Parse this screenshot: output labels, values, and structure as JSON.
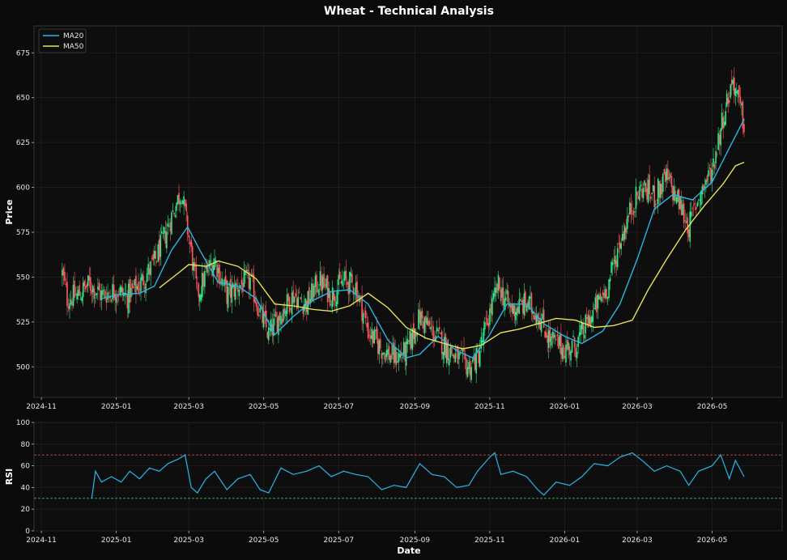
{
  "chart_data": [
    {
      "type": "candlestick",
      "title": "Wheat - Technical Analysis",
      "ylabel": "Price",
      "xlabel": "",
      "ylim": [
        483,
        690
      ],
      "xlim": [
        "2024-10-26",
        "2026-06-27"
      ],
      "yticks": [
        500,
        525,
        550,
        575,
        600,
        625,
        650,
        675
      ],
      "xticks": [
        "2024-11",
        "2025-01",
        "2025-03",
        "2025-05",
        "2025-07",
        "2025-09",
        "2025-11",
        "2026-01",
        "2026-03",
        "2026-05"
      ],
      "grid": true,
      "legend_position": "top-left",
      "up_color": "#2ee88a",
      "down_color": "#ff5a5f",
      "close_anchors": [
        [
          "2024-11-18",
          552
        ],
        [
          "2024-11-22",
          538
        ],
        [
          "2024-12-01",
          540
        ],
        [
          "2024-12-10",
          546
        ],
        [
          "2024-12-20",
          540
        ],
        [
          "2025-01-01",
          543
        ],
        [
          "2025-01-10",
          539
        ],
        [
          "2025-01-20",
          546
        ],
        [
          "2025-02-01",
          558
        ],
        [
          "2025-02-10",
          574
        ],
        [
          "2025-02-18",
          590
        ],
        [
          "2025-02-23",
          598
        ],
        [
          "2025-03-02",
          568
        ],
        [
          "2025-03-08",
          540
        ],
        [
          "2025-03-15",
          552
        ],
        [
          "2025-03-22",
          560
        ],
        [
          "2025-04-01",
          540
        ],
        [
          "2025-04-10",
          545
        ],
        [
          "2025-04-20",
          548
        ],
        [
          "2025-04-28",
          530
        ],
        [
          "2025-05-05",
          518
        ],
        [
          "2025-05-15",
          530
        ],
        [
          "2025-05-25",
          540
        ],
        [
          "2025-06-05",
          535
        ],
        [
          "2025-06-15",
          548
        ],
        [
          "2025-06-25",
          540
        ],
        [
          "2025-07-05",
          548
        ],
        [
          "2025-07-15",
          545
        ],
        [
          "2025-07-25",
          520
        ],
        [
          "2025-08-05",
          510
        ],
        [
          "2025-08-15",
          505
        ],
        [
          "2025-08-25",
          508
        ],
        [
          "2025-09-05",
          528
        ],
        [
          "2025-09-15",
          520
        ],
        [
          "2025-09-25",
          512
        ],
        [
          "2025-10-05",
          505
        ],
        [
          "2025-10-15",
          500
        ],
        [
          "2025-10-22",
          505
        ],
        [
          "2025-11-01",
          530
        ],
        [
          "2025-11-08",
          545
        ],
        [
          "2025-11-18",
          532
        ],
        [
          "2025-12-01",
          535
        ],
        [
          "2025-12-10",
          530
        ],
        [
          "2025-12-20",
          515
        ],
        [
          "2026-01-01",
          510
        ],
        [
          "2026-01-10",
          512
        ],
        [
          "2026-01-20",
          525
        ],
        [
          "2026-01-28",
          535
        ],
        [
          "2026-02-05",
          545
        ],
        [
          "2026-02-15",
          570
        ],
        [
          "2026-02-25",
          590
        ],
        [
          "2026-03-05",
          600
        ],
        [
          "2026-03-15",
          595
        ],
        [
          "2026-03-25",
          605
        ],
        [
          "2026-04-05",
          590
        ],
        [
          "2026-04-12",
          578
        ],
        [
          "2026-04-20",
          595
        ],
        [
          "2026-05-01",
          610
        ],
        [
          "2026-05-10",
          640
        ],
        [
          "2026-05-18",
          660
        ],
        [
          "2026-05-27",
          635
        ]
      ],
      "series": [
        {
          "name": "MA20",
          "color": "#29b6e8",
          "points": [
            [
              "2024-12-20",
              538
            ],
            [
              "2025-01-01",
              540
            ],
            [
              "2025-01-20",
              541
            ],
            [
              "2025-02-01",
              545
            ],
            [
              "2025-02-15",
              565
            ],
            [
              "2025-02-28",
              578
            ],
            [
              "2025-03-10",
              565
            ],
            [
              "2025-03-25",
              547
            ],
            [
              "2025-04-10",
              545
            ],
            [
              "2025-04-25",
              538
            ],
            [
              "2025-05-10",
              518
            ],
            [
              "2025-05-25",
              528
            ],
            [
              "2025-06-10",
              537
            ],
            [
              "2025-06-25",
              542
            ],
            [
              "2025-07-10",
              543
            ],
            [
              "2025-07-25",
              535
            ],
            [
              "2025-08-10",
              515
            ],
            [
              "2025-08-25",
              505
            ],
            [
              "2025-09-05",
              507
            ],
            [
              "2025-09-20",
              517
            ],
            [
              "2025-10-05",
              509
            ],
            [
              "2025-10-18",
              505
            ],
            [
              "2025-11-01",
              518
            ],
            [
              "2025-11-15",
              535
            ],
            [
              "2025-12-01",
              535
            ],
            [
              "2025-12-15",
              524
            ],
            [
              "2026-01-01",
              517
            ],
            [
              "2026-01-15",
              513
            ],
            [
              "2026-02-01",
              520
            ],
            [
              "2026-02-15",
              535
            ],
            [
              "2026-03-01",
              560
            ],
            [
              "2026-03-15",
              588
            ],
            [
              "2026-03-30",
              596
            ],
            [
              "2026-04-15",
              593
            ],
            [
              "2026-05-01",
              603
            ],
            [
              "2026-05-15",
              622
            ],
            [
              "2026-05-27",
              638
            ]
          ]
        },
        {
          "name": "MA50",
          "color": "#e6e25a",
          "points": [
            [
              "2025-02-05",
              544
            ],
            [
              "2025-02-20",
              552
            ],
            [
              "2025-03-01",
              557
            ],
            [
              "2025-03-15",
              556
            ],
            [
              "2025-03-25",
              559
            ],
            [
              "2025-04-10",
              556
            ],
            [
              "2025-04-25",
              549
            ],
            [
              "2025-05-10",
              535
            ],
            [
              "2025-05-25",
              534
            ],
            [
              "2025-06-10",
              532
            ],
            [
              "2025-06-25",
              531
            ],
            [
              "2025-07-10",
              534
            ],
            [
              "2025-07-25",
              541
            ],
            [
              "2025-08-10",
              533
            ],
            [
              "2025-08-25",
              522
            ],
            [
              "2025-09-10",
              516
            ],
            [
              "2025-09-25",
              513
            ],
            [
              "2025-10-10",
              510
            ],
            [
              "2025-10-25",
              512
            ],
            [
              "2025-11-10",
              519
            ],
            [
              "2025-11-25",
              521
            ],
            [
              "2025-12-10",
              524
            ],
            [
              "2025-12-25",
              527
            ],
            [
              "2026-01-10",
              526
            ],
            [
              "2026-01-25",
              522
            ],
            [
              "2026-02-10",
              523
            ],
            [
              "2026-02-25",
              526
            ],
            [
              "2026-03-10",
              543
            ],
            [
              "2026-03-25",
              560
            ],
            [
              "2026-04-10",
              577
            ],
            [
              "2026-04-25",
              590
            ],
            [
              "2026-05-10",
              602
            ],
            [
              "2026-05-20",
              612
            ],
            [
              "2026-05-27",
              614
            ]
          ]
        }
      ]
    },
    {
      "type": "line",
      "title": "",
      "ylabel": "RSI",
      "xlabel": "Date",
      "ylim": [
        0,
        100
      ],
      "xlim": [
        "2024-10-26",
        "2026-06-27"
      ],
      "yticks": [
        0,
        20,
        40,
        60,
        80,
        100
      ],
      "xticks": [
        "2024-11",
        "2025-01",
        "2025-03",
        "2025-05",
        "2025-07",
        "2025-09",
        "2025-11",
        "2026-01",
        "2026-03",
        "2026-05"
      ],
      "grid": true,
      "reference_lines": [
        {
          "value": 70,
          "color": "#ff5a5f"
        },
        {
          "value": 30,
          "color": "#2ee88a"
        }
      ],
      "series": [
        {
          "name": "RSI",
          "color": "#29b6e8",
          "points": [
            [
              "2024-12-12",
              30
            ],
            [
              "2024-12-15",
              55
            ],
            [
              "2024-12-20",
              45
            ],
            [
              "2024-12-28",
              50
            ],
            [
              "2025-01-05",
              45
            ],
            [
              "2025-01-12",
              55
            ],
            [
              "2025-01-20",
              48
            ],
            [
              "2025-01-28",
              58
            ],
            [
              "2025-02-05",
              55
            ],
            [
              "2025-02-12",
              62
            ],
            [
              "2025-02-20",
              66
            ],
            [
              "2025-02-26",
              70
            ],
            [
              "2025-03-03",
              40
            ],
            [
              "2025-03-08",
              35
            ],
            [
              "2025-03-15",
              48
            ],
            [
              "2025-03-22",
              55
            ],
            [
              "2025-04-01",
              38
            ],
            [
              "2025-04-10",
              48
            ],
            [
              "2025-04-20",
              52
            ],
            [
              "2025-04-28",
              38
            ],
            [
              "2025-05-05",
              35
            ],
            [
              "2025-05-15",
              58
            ],
            [
              "2025-05-25",
              52
            ],
            [
              "2025-06-05",
              55
            ],
            [
              "2025-06-15",
              60
            ],
            [
              "2025-06-25",
              50
            ],
            [
              "2025-07-05",
              55
            ],
            [
              "2025-07-15",
              52
            ],
            [
              "2025-07-25",
              50
            ],
            [
              "2025-08-05",
              38
            ],
            [
              "2025-08-15",
              42
            ],
            [
              "2025-08-25",
              40
            ],
            [
              "2025-09-05",
              62
            ],
            [
              "2025-09-15",
              52
            ],
            [
              "2025-09-25",
              50
            ],
            [
              "2025-10-05",
              40
            ],
            [
              "2025-10-15",
              42
            ],
            [
              "2025-10-22",
              55
            ],
            [
              "2025-11-01",
              68
            ],
            [
              "2025-11-05",
              72
            ],
            [
              "2025-11-10",
              52
            ],
            [
              "2025-11-20",
              55
            ],
            [
              "2025-12-01",
              50
            ],
            [
              "2025-12-10",
              38
            ],
            [
              "2025-12-15",
              33
            ],
            [
              "2025-12-25",
              45
            ],
            [
              "2026-01-05",
              42
            ],
            [
              "2026-01-15",
              50
            ],
            [
              "2026-01-25",
              62
            ],
            [
              "2026-02-05",
              60
            ],
            [
              "2026-02-15",
              68
            ],
            [
              "2026-02-25",
              72
            ],
            [
              "2026-03-05",
              65
            ],
            [
              "2026-03-15",
              55
            ],
            [
              "2026-03-25",
              60
            ],
            [
              "2026-04-05",
              55
            ],
            [
              "2026-04-12",
              42
            ],
            [
              "2026-04-20",
              55
            ],
            [
              "2026-05-01",
              60
            ],
            [
              "2026-05-08",
              70
            ],
            [
              "2026-05-15",
              48
            ],
            [
              "2026-05-20",
              65
            ],
            [
              "2026-05-27",
              50
            ]
          ]
        }
      ]
    }
  ]
}
